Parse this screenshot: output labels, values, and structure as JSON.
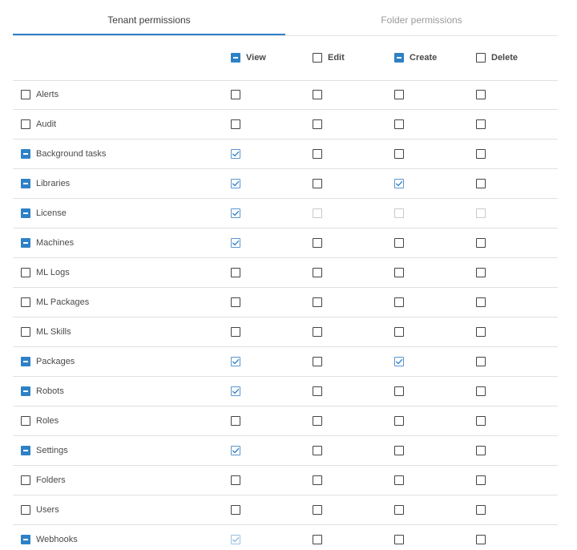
{
  "tabs": [
    {
      "label": "Tenant permissions",
      "active": true
    },
    {
      "label": "Folder permissions",
      "active": false
    }
  ],
  "columns": [
    {
      "label": "View",
      "state": "indeterminate"
    },
    {
      "label": "Edit",
      "state": "unchecked"
    },
    {
      "label": "Create",
      "state": "indeterminate"
    },
    {
      "label": "Delete",
      "state": "unchecked"
    }
  ],
  "rows": [
    {
      "label": "Alerts",
      "state": "unchecked",
      "cells": [
        "unchecked",
        "unchecked",
        "unchecked",
        "unchecked"
      ]
    },
    {
      "label": "Audit",
      "state": "unchecked",
      "cells": [
        "unchecked",
        "unchecked",
        "unchecked",
        "unchecked"
      ]
    },
    {
      "label": "Background tasks",
      "state": "indeterminate",
      "cells": [
        "checked",
        "unchecked",
        "unchecked",
        "unchecked"
      ]
    },
    {
      "label": "Libraries",
      "state": "indeterminate",
      "cells": [
        "checked",
        "unchecked",
        "checked",
        "unchecked"
      ]
    },
    {
      "label": "License",
      "state": "indeterminate",
      "cells": [
        "checked",
        "disabled",
        "disabled",
        "disabled"
      ]
    },
    {
      "label": "Machines",
      "state": "indeterminate",
      "cells": [
        "checked",
        "unchecked",
        "unchecked",
        "unchecked"
      ]
    },
    {
      "label": "ML Logs",
      "state": "unchecked",
      "cells": [
        "unchecked",
        "unchecked",
        "unchecked",
        "unchecked"
      ]
    },
    {
      "label": "ML Packages",
      "state": "unchecked",
      "cells": [
        "unchecked",
        "unchecked",
        "unchecked",
        "unchecked"
      ]
    },
    {
      "label": "ML Skills",
      "state": "unchecked",
      "cells": [
        "unchecked",
        "unchecked",
        "unchecked",
        "unchecked"
      ]
    },
    {
      "label": "Packages",
      "state": "indeterminate",
      "cells": [
        "checked",
        "unchecked",
        "checked",
        "unchecked"
      ]
    },
    {
      "label": "Robots",
      "state": "indeterminate",
      "cells": [
        "checked",
        "unchecked",
        "unchecked",
        "unchecked"
      ]
    },
    {
      "label": "Roles",
      "state": "unchecked",
      "cells": [
        "unchecked",
        "unchecked",
        "unchecked",
        "unchecked"
      ]
    },
    {
      "label": "Settings",
      "state": "indeterminate",
      "cells": [
        "checked",
        "unchecked",
        "unchecked",
        "unchecked"
      ]
    },
    {
      "label": "Folders",
      "state": "unchecked",
      "cells": [
        "unchecked",
        "unchecked",
        "unchecked",
        "unchecked"
      ]
    },
    {
      "label": "Users",
      "state": "unchecked",
      "cells": [
        "unchecked",
        "unchecked",
        "unchecked",
        "unchecked"
      ]
    },
    {
      "label": "Webhooks",
      "state": "indeterminate",
      "cells": [
        "checked-disabled",
        "unchecked",
        "unchecked",
        "unchecked"
      ]
    }
  ],
  "colors": {
    "accent": "#2e81c7",
    "check": "#2e81c7",
    "divider": "#e0e0e0"
  }
}
